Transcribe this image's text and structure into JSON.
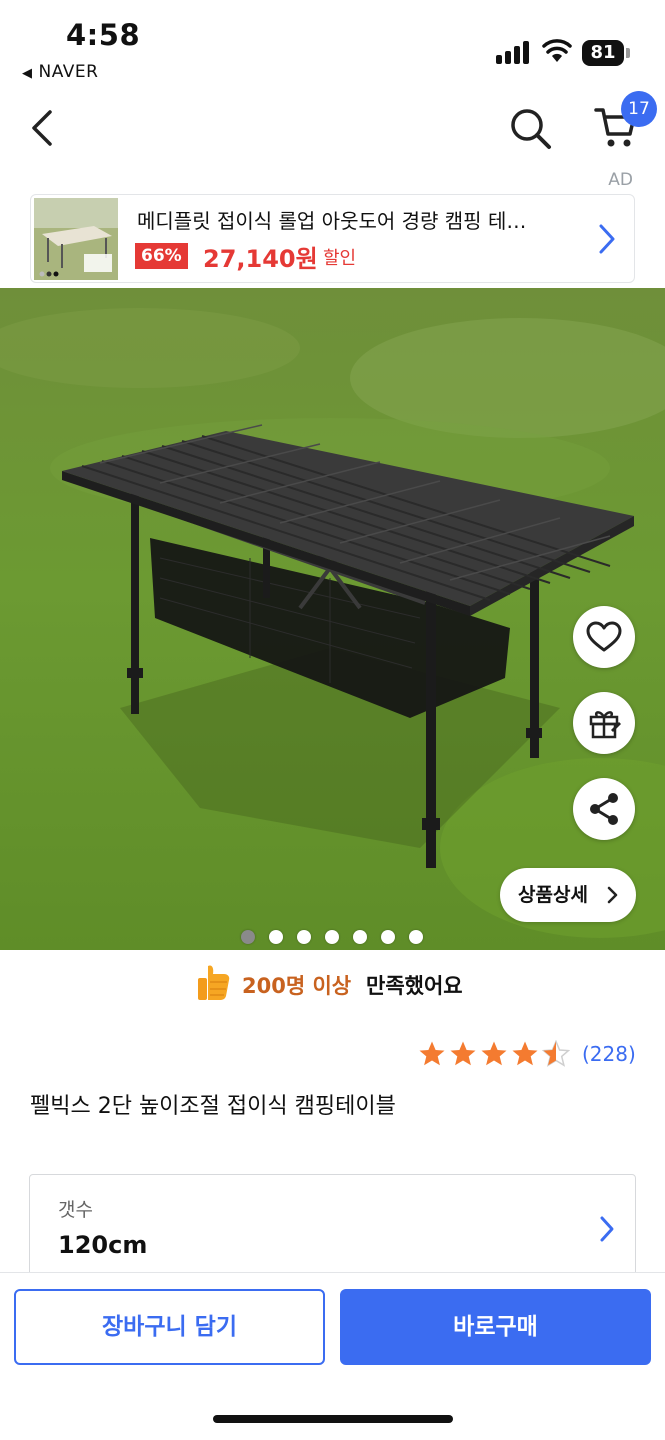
{
  "status_bar": {
    "time": "4:58",
    "back_app": "NAVER",
    "battery": "81"
  },
  "nav": {
    "cart_count": "17"
  },
  "ad": {
    "label": "AD",
    "title": "메디플릿 접이식 롤업 아웃도어 경량 캠핑 테…",
    "discount": "66%",
    "price": "27,140원",
    "sale_text": "할인"
  },
  "gallery": {
    "detail_button": "상품상세",
    "image_count": 7,
    "active_index": 0
  },
  "satisfaction": {
    "highlight": "200명 이상",
    "rest": "만족했어요"
  },
  "rating": {
    "stars": 4.5,
    "review_count": "(228)"
  },
  "product": {
    "title": "펠빅스 2단 높이조절 접이식 캠핑테이블"
  },
  "option": {
    "label": "갯수",
    "value": "120cm"
  },
  "bottom": {
    "cart_button": "장바구니 담기",
    "buy_button": "바로구매"
  },
  "colors": {
    "accent": "#3b6cf1",
    "discount": "#e53935",
    "satisfaction": "#c8621f",
    "star": "#f47b30"
  },
  "icons": [
    "back-icon",
    "search-icon",
    "cart-icon",
    "chevron-right-icon",
    "heart-icon",
    "gift-icon",
    "share-icon",
    "thumbs-up-icon",
    "star-icon"
  ]
}
